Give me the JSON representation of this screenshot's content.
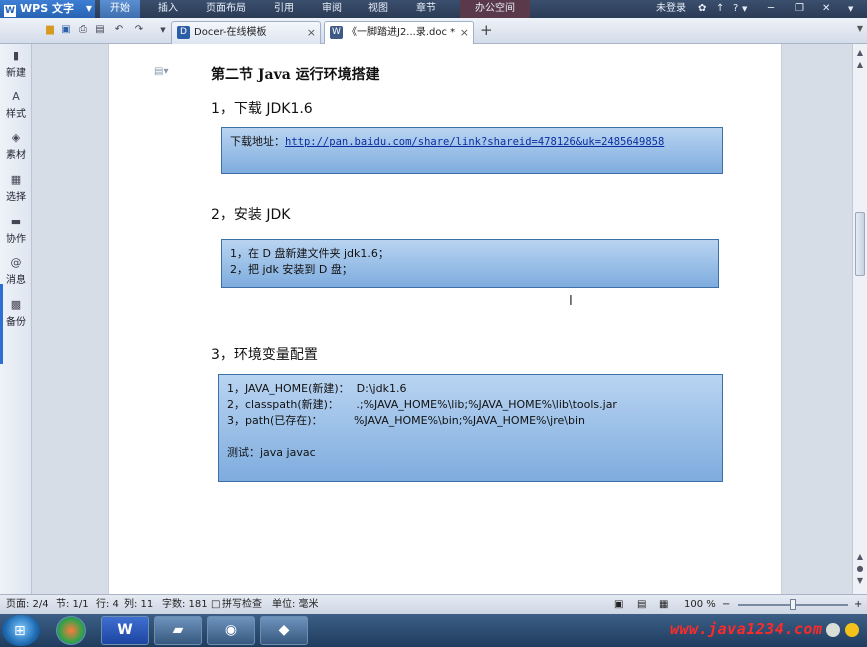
{
  "app": {
    "name": "WPS 文字"
  },
  "ribbon": {
    "tabs": [
      "开始",
      "插入",
      "页面布局",
      "引用",
      "审阅",
      "视图",
      "章节",
      "办公空间"
    ],
    "active_tab": "开始",
    "login": "未登录",
    "help": "?"
  },
  "doc_tabs": [
    {
      "label": "Docer-在线模板",
      "icon": "D"
    },
    {
      "label": "《一脚踏进J2...录.doc *",
      "icon": "W"
    }
  ],
  "sidebar": {
    "items": [
      {
        "label": "新建",
        "icon": "new-icon"
      },
      {
        "label": "样式",
        "icon": "style-icon"
      },
      {
        "label": "素材",
        "icon": "material-icon"
      },
      {
        "label": "选择",
        "icon": "select-icon"
      },
      {
        "label": "协作",
        "icon": "collab-icon"
      },
      {
        "label": "消息",
        "icon": "message-icon"
      },
      {
        "label": "备份",
        "icon": "backup-icon"
      }
    ]
  },
  "document": {
    "section_title": "第二节  Java 运行环境搭建",
    "step1": {
      "heading": "1，下载 JDK1.6",
      "box_label": "下载地址：",
      "link": "http://pan.baidu.com/share/link?shareid=478126&uk=2485649858"
    },
    "step2": {
      "heading": "2，安装 JDK",
      "lines": [
        "1，在 D 盘新建文件夹 jdk1.6；",
        "2，把 jdk 安装到 D 盘；"
      ]
    },
    "step3": {
      "heading": "3，环境变量配置",
      "lines": [
        "1，JAVA_HOME(新建)：  D:\\jdk1.6",
        "2，classpath(新建)：     .;%JAVA_HOME%\\lib;%JAVA_HOME%\\lib\\tools.jar",
        "3，path(已存在)：         %JAVA_HOME%\\bin;%JAVA_HOME%\\jre\\bin"
      ],
      "test_line": "测试：java javac"
    }
  },
  "status_bar": {
    "page": "页面: 2/4",
    "section": "节: 1/1",
    "row": "行: 4",
    "col": "列: 11",
    "words": "字数: 181",
    "spellcheck": "拼写检查",
    "unit": "单位: 毫米",
    "zoom": "100 %",
    "zoom_level": 0.5
  },
  "taskbar": {
    "watermark": "www.java1234.com",
    "apps": [
      "wps-writer",
      "media-app",
      "chrome",
      "tool-app"
    ]
  }
}
